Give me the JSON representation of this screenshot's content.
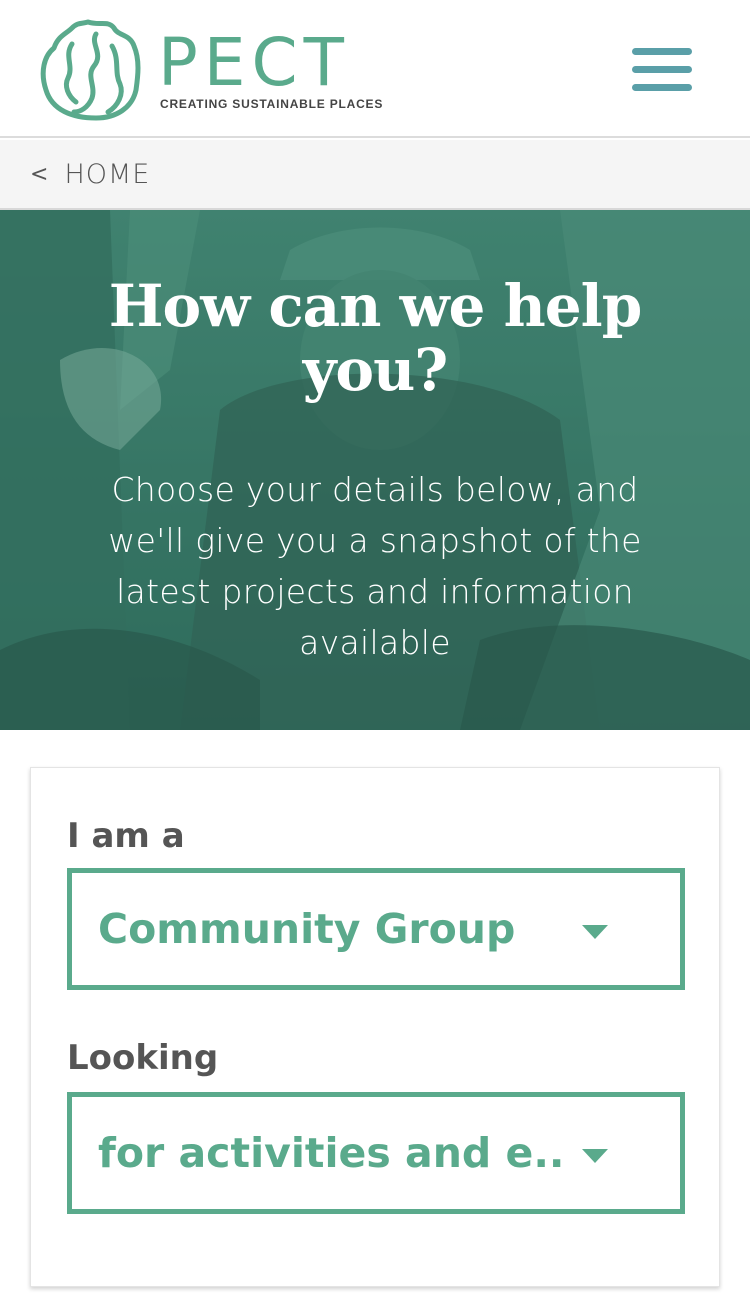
{
  "header": {
    "logo_word": "PECT",
    "logo_tagline": "CREATING SUSTAINABLE PLACES",
    "menu_icon": "hamburger-menu-icon"
  },
  "breadcrumb": {
    "chevron": "<",
    "label": "HOME"
  },
  "hero": {
    "title": "How can we help you?",
    "subtitle": "Choose your details below, and we'll give you a snapshot of the latest projects and information available"
  },
  "form": {
    "iam_label": "I am a",
    "iam_value": "Community Group",
    "looking_label": "Looking",
    "looking_value": "for activities and e..."
  },
  "colors": {
    "brand_green": "#5aaa8c",
    "menu_teal": "#5a9fa8",
    "hero_tint": "#3f7f6e",
    "label_grey": "#555555"
  }
}
